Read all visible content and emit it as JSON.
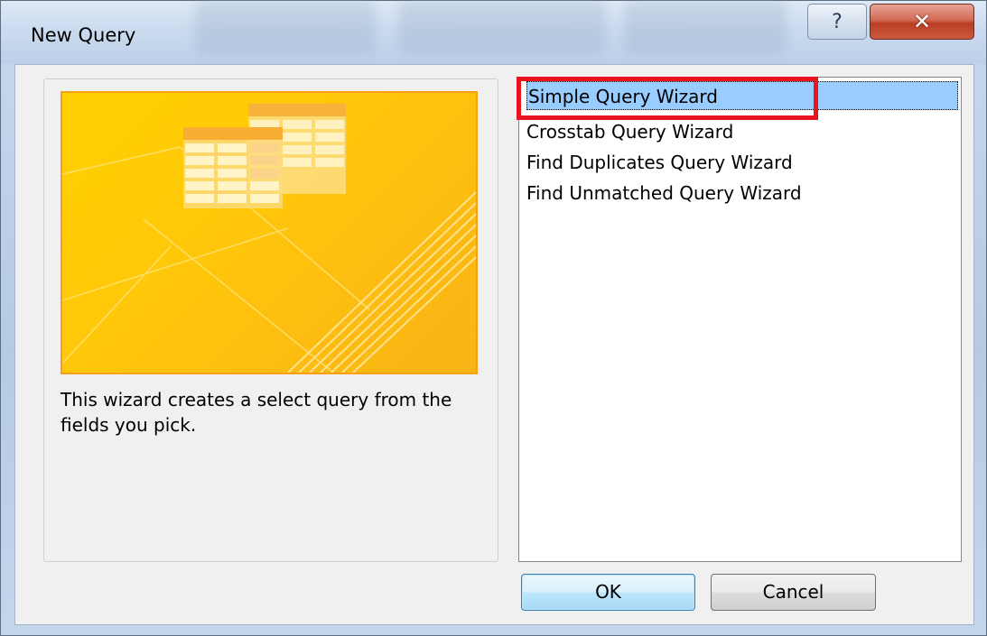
{
  "window": {
    "title": "New Query",
    "help_glyph": "?",
    "close_glyph": "✕",
    "help_icon": "help-icon",
    "close_icon": "close-icon"
  },
  "preview": {
    "image": "query-wizard-illustration",
    "description": "This wizard creates a select query from the fields you pick."
  },
  "list": {
    "items": [
      "Simple Query Wizard",
      "Crosstab Query Wizard",
      "Find Duplicates Query Wizard",
      "Find Unmatched Query Wizard"
    ],
    "selected_index": 0
  },
  "buttons": {
    "ok": "OK",
    "cancel": "Cancel"
  },
  "colors": {
    "selection": "#99ccff",
    "annotation_highlight": "#e8141f",
    "preview_accent": "#f7a013"
  }
}
